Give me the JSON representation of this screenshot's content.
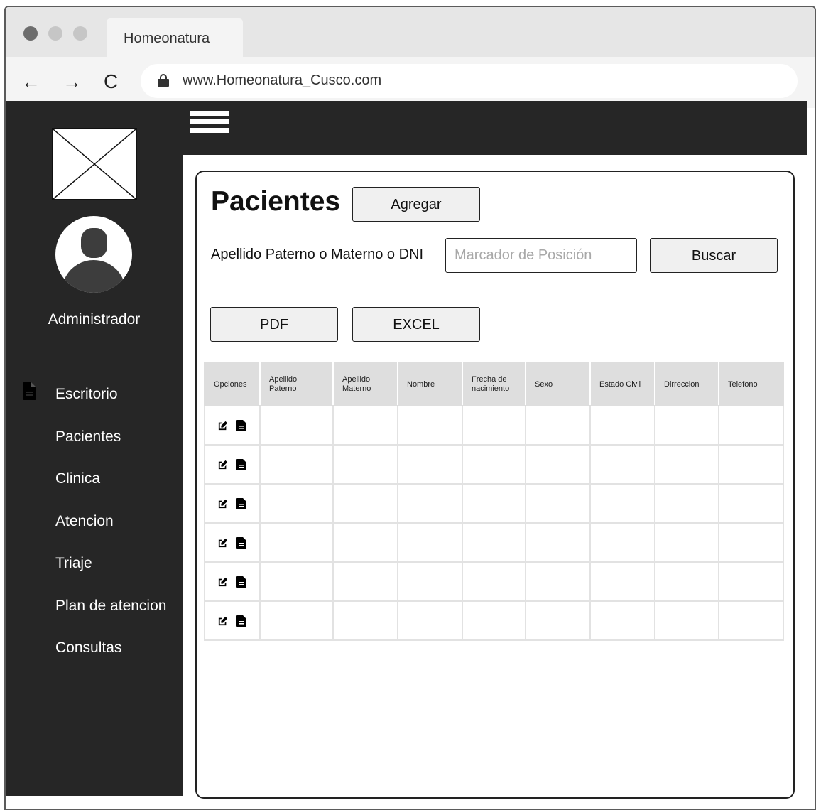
{
  "browser": {
    "tab_title": "Homeonatura",
    "url": "www.Homeonatura_Cusco.com",
    "nav": {
      "back_icon": "←",
      "forward_icon": "→",
      "reload_icon": "C"
    }
  },
  "sidebar": {
    "user_name": "Administrador",
    "items": [
      {
        "label": "Escritorio",
        "icon": "document-icon"
      },
      {
        "label": "Pacientes"
      },
      {
        "label": "Clinica"
      },
      {
        "label": "Atencion"
      },
      {
        "label": "Triaje"
      },
      {
        "label": "Plan de atencion"
      },
      {
        "label": "Consultas"
      }
    ]
  },
  "main": {
    "title": "Pacientes",
    "add_button": "Agregar",
    "search": {
      "label": "Apellido Paterno o Materno o DNI",
      "placeholder": "Marcador de Posición",
      "value": "",
      "button": "Buscar"
    },
    "export": {
      "pdf": "PDF",
      "excel": "EXCEL"
    },
    "table": {
      "columns": [
        "Opciones",
        "Apellido Paterno",
        "Apellido Materno",
        "Nombre",
        "Frecha de nacimiento",
        "Sexo",
        "Estado Civil",
        "Dirreccion",
        "Telefono"
      ],
      "row_count": 6,
      "row_actions": [
        "edit-icon",
        "file-icon"
      ]
    }
  },
  "colors": {
    "sidebar_bg": "#262626",
    "header_row_bg": "#dedede",
    "button_bg": "#f0f0f0"
  }
}
